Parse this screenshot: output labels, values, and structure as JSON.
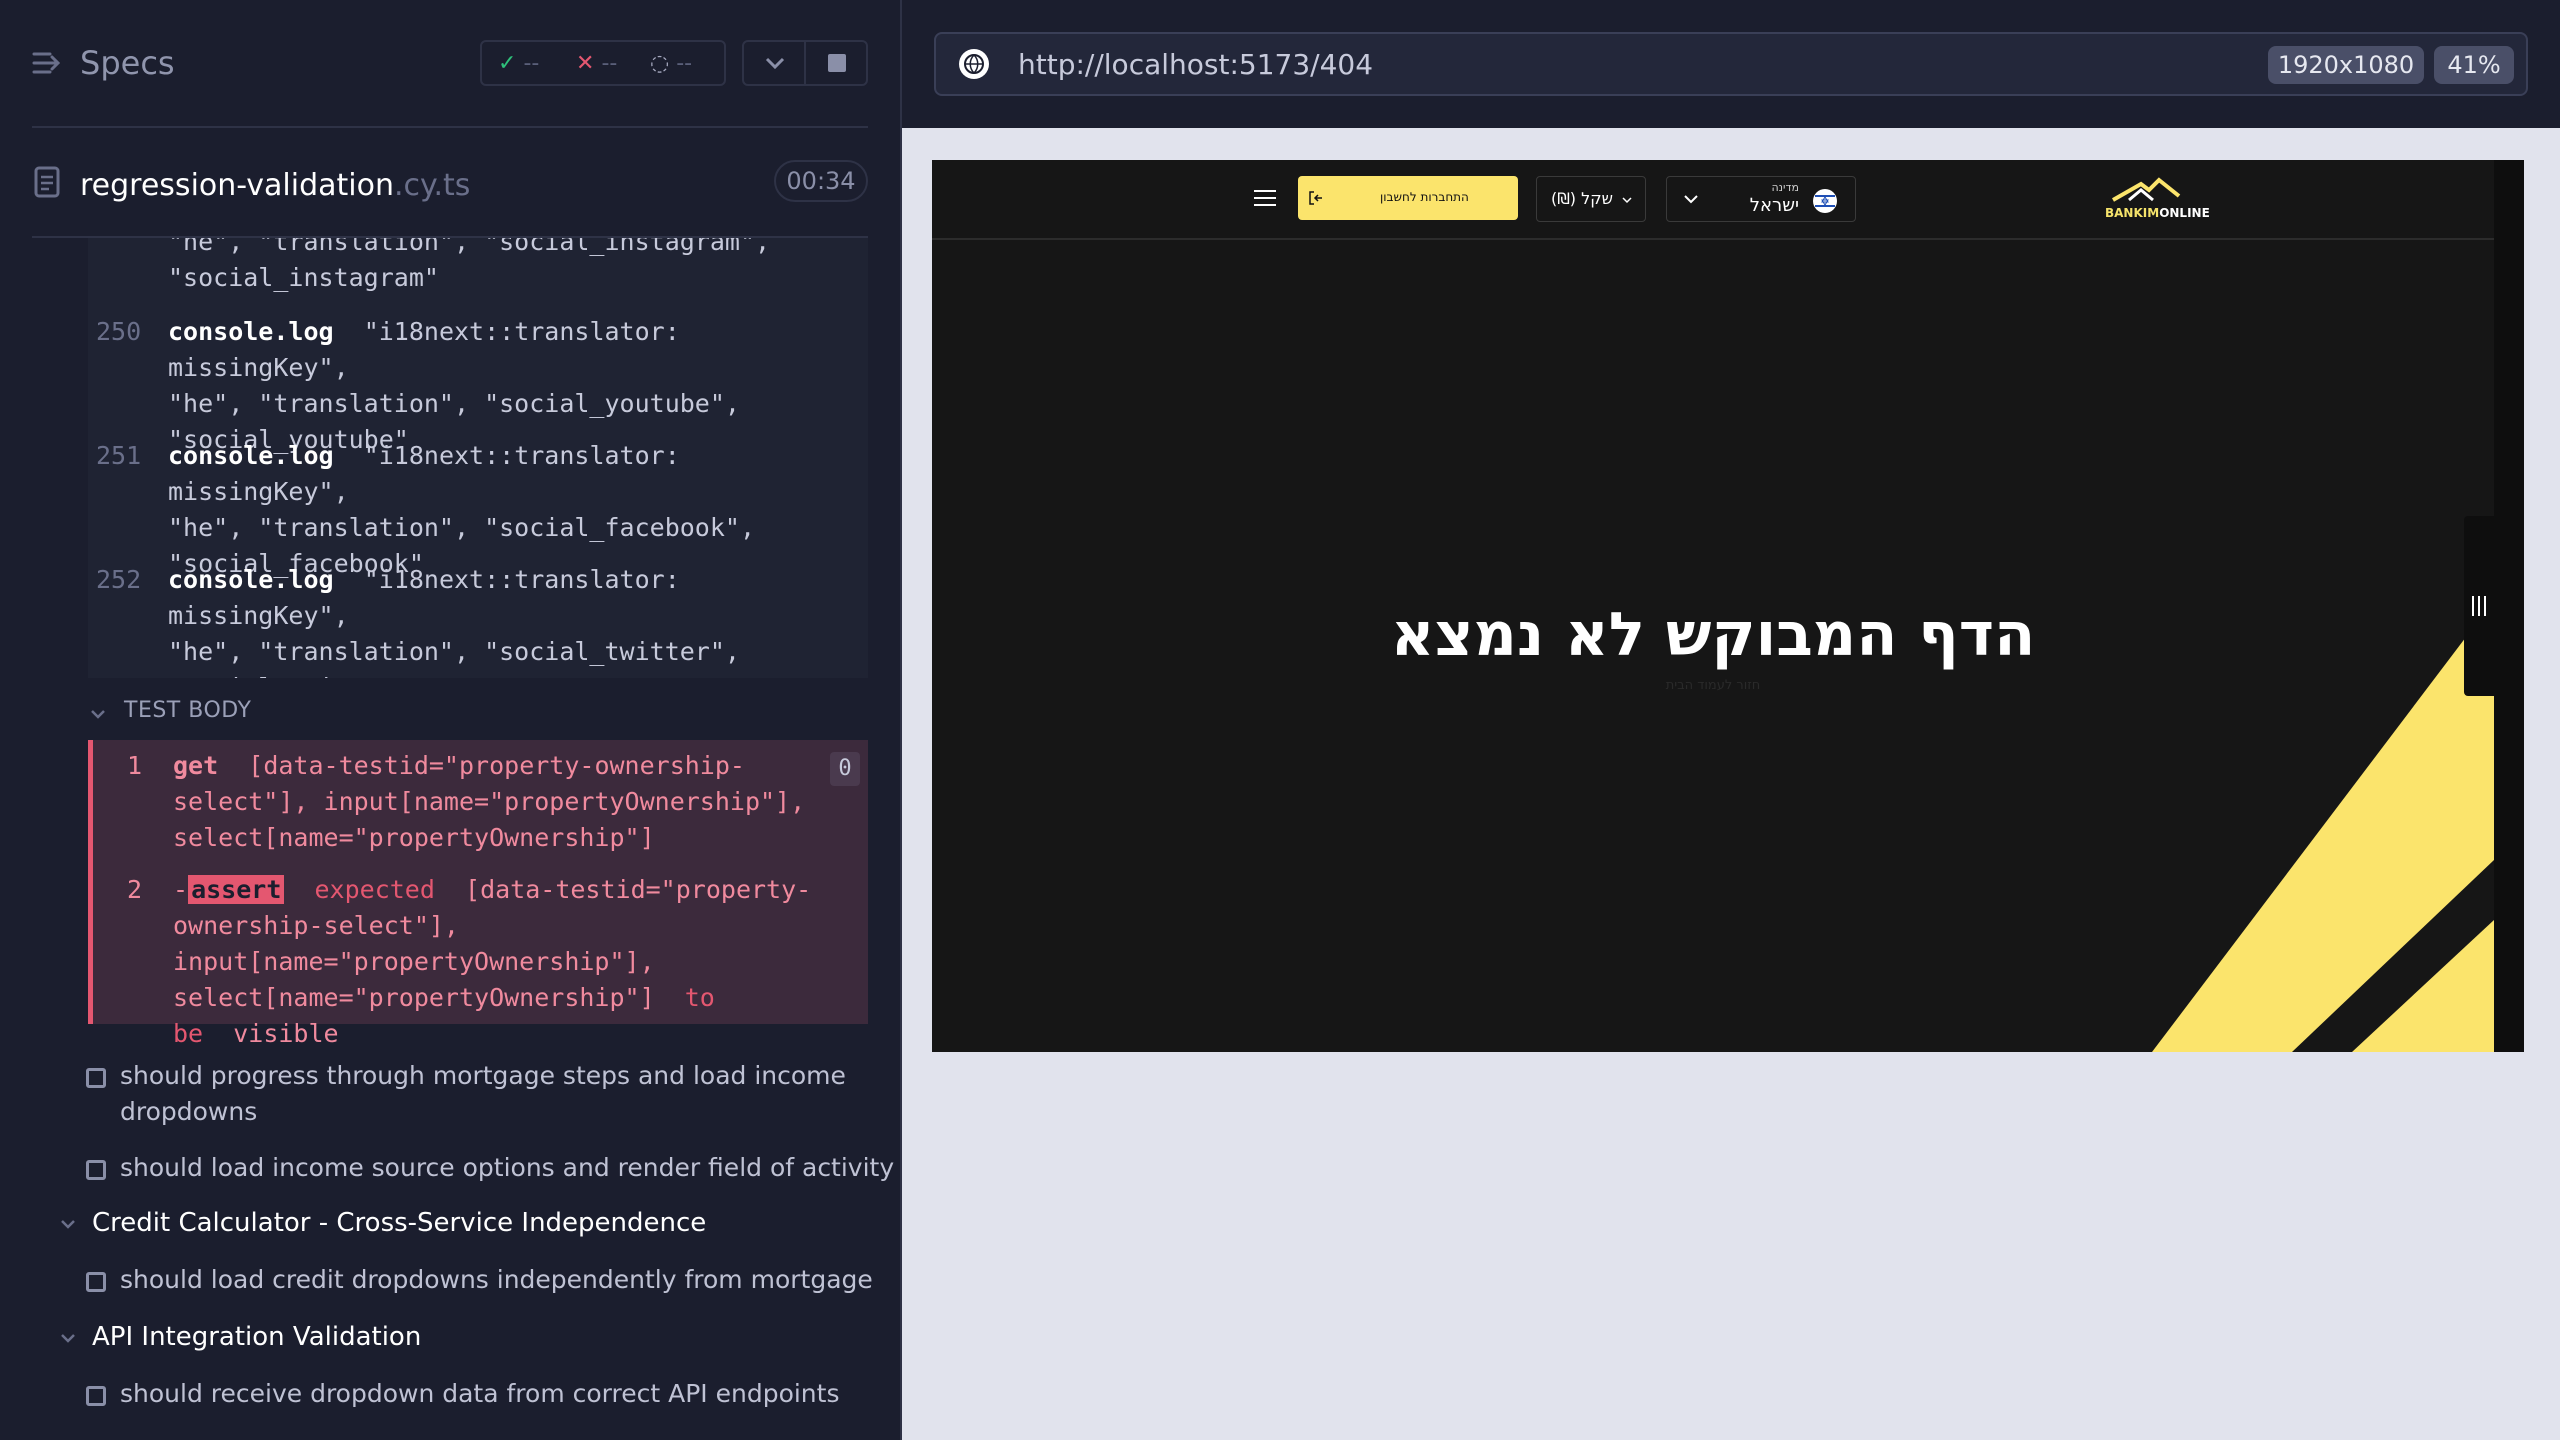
{
  "sidebar": {
    "title": "Specs",
    "stats": {
      "passed": "--",
      "failed": "--",
      "pending": "--"
    },
    "file": {
      "name": "regression-validation",
      "ext": ".cy.ts"
    },
    "timer": "00:34",
    "log": [
      {
        "num": "",
        "lines": [
          "\"he\", \"translation\", \"social_instagram\",",
          "\"social_instagram\""
        ]
      },
      {
        "num": "250",
        "cmd": "console.log",
        "lines": [
          "\"i18next::translator: missingKey\",",
          "\"he\", \"translation\", \"social_youtube\",",
          "\"social_youtube\""
        ]
      },
      {
        "num": "251",
        "cmd": "console.log",
        "lines": [
          "\"i18next::translator: missingKey\",",
          "\"he\", \"translation\", \"social_facebook\",",
          "\"social_facebook\""
        ]
      },
      {
        "num": "252",
        "cmd": "console.log",
        "lines": [
          "\"i18next::translator: missingKey\",",
          "\"he\", \"translation\", \"social_twitter\",",
          "\"social_twitter\""
        ]
      }
    ],
    "test_body_label": "TEST BODY",
    "test_body": {
      "badge": "0",
      "cmd1": {
        "num": "1",
        "name": "get",
        "lines": [
          "[data-testid=\"property-ownership-",
          "select\"], input[name=\"propertyOwnership\"],",
          "select[name=\"propertyOwnership\"]"
        ]
      },
      "cmd2": {
        "num": "2",
        "prefix": "-",
        "assert": "assert",
        "expected": "expected",
        "lines": [
          "[data-testid=\"property-",
          "ownership-select\"],",
          "input[name=\"propertyOwnership\"],",
          "select[name=\"propertyOwnership\"]"
        ],
        "to_be": "to be",
        "visible": "visible"
      }
    },
    "tests": [
      {
        "label_lines": [
          "should progress through mortgage steps and load income",
          "dropdowns"
        ]
      },
      {
        "label_lines": [
          "should load income source options and render field of activity"
        ]
      }
    ],
    "suites": [
      {
        "title": "Credit Calculator - Cross-Service Independence",
        "tests": [
          "should load credit dropdowns independently from mortgage"
        ]
      },
      {
        "title": "API Integration Validation",
        "tests": [
          "should receive dropdown data from correct API endpoints"
        ]
      }
    ]
  },
  "browser": {
    "url": "http://localhost:5173/404",
    "viewport": "1920x1080",
    "zoom": "41%"
  },
  "app": {
    "logo": {
      "part1": "BANKIM",
      "part2": "ONLINE"
    },
    "country_label": "מדינה",
    "country_name": "ישראל",
    "currency": "(₪) שקל",
    "login_label": "התחברות לחשבון",
    "not_found_title": "הדף המבוקש לא נמצא",
    "not_found_sub": "חזור לעמוד הבית",
    "colors": {
      "accent": "#fbe46c",
      "bg": "#161616"
    }
  }
}
